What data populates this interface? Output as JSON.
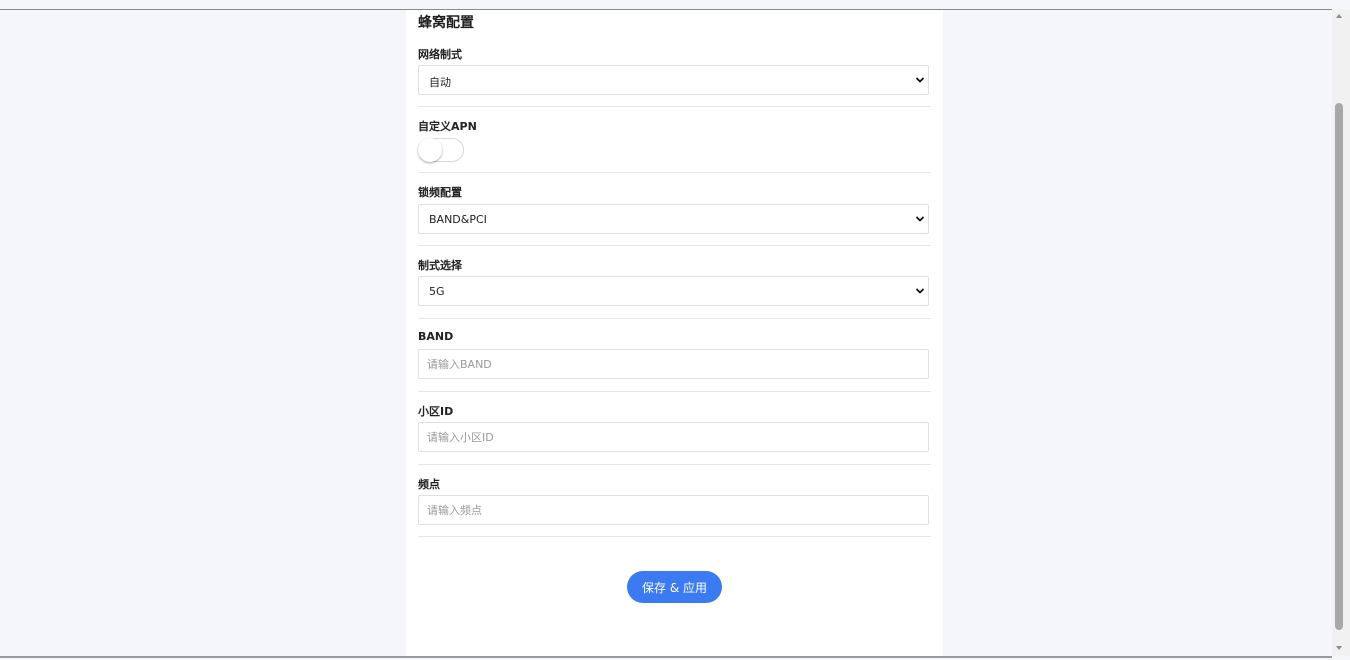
{
  "section": {
    "title": "蜂窝配置"
  },
  "network_mode": {
    "label": "网络制式",
    "value": "自动"
  },
  "custom_apn": {
    "label": "自定义APN",
    "enabled": false
  },
  "freq_lock": {
    "label": "锁频配置",
    "value": "BAND&PCI"
  },
  "mode_select": {
    "label": "制式选择",
    "value": "5G"
  },
  "band": {
    "label": "BAND",
    "placeholder": "请输入BAND"
  },
  "cell_id": {
    "label": "小区ID",
    "placeholder": "请输入小区ID"
  },
  "freq_point": {
    "label": "频点",
    "placeholder": "请输入频点"
  },
  "actions": {
    "save_label": "保存 & 应用"
  },
  "colors": {
    "accent": "#3b7af0",
    "background": "#f5f6fa",
    "panel": "#ffffff"
  }
}
